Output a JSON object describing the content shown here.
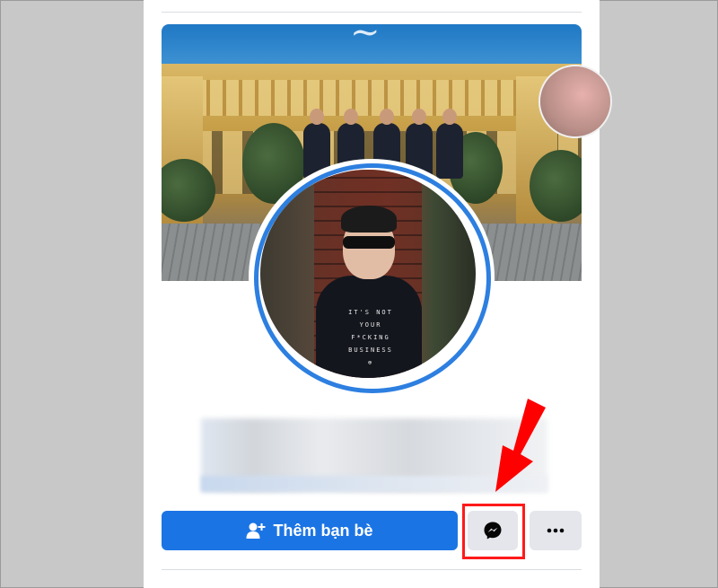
{
  "profile": {
    "cover_script_text": "~",
    "shirt_text_lines": [
      "IT'S NOT",
      "YOUR",
      "F*CKING",
      "BUSINESS",
      "⊕"
    ]
  },
  "actions": {
    "add_friend_label": "Thêm bạn bè",
    "add_friend_icon": "add-friend-icon",
    "messenger_icon": "messenger-icon",
    "more_icon": "more-options-icon"
  },
  "annotation": {
    "arrow_color": "#ff0000",
    "highlight_color": "#ff1a1a"
  },
  "colors": {
    "primary": "#1b74e4",
    "secondary_button": "#e4e6eb",
    "avatar_ring": "#2d7fe0"
  }
}
